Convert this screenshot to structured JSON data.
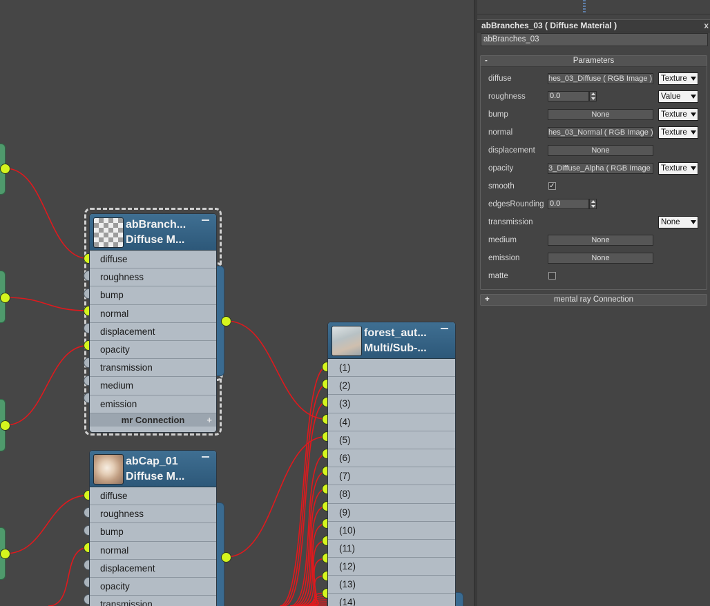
{
  "node_editor": {
    "nodes": [
      {
        "title_line1": "abBranch...",
        "title_line2": "Diffuse M...",
        "slots": [
          {
            "label": "diffuse",
            "connected": true
          },
          {
            "label": "roughness",
            "connected": false
          },
          {
            "label": "bump",
            "connected": false
          },
          {
            "label": "normal",
            "connected": true
          },
          {
            "label": "displacement",
            "connected": false
          },
          {
            "label": "opacity",
            "connected": true
          },
          {
            "label": "transmission",
            "connected": false
          },
          {
            "label": "medium",
            "connected": false
          },
          {
            "label": "emission",
            "connected": false
          }
        ],
        "mr_connection_label": "mr Connection",
        "mr_connection_plus": "+"
      },
      {
        "title_line1": "abCap_01",
        "title_line2": "Diffuse M...",
        "slots": [
          {
            "label": "diffuse",
            "connected": true
          },
          {
            "label": "roughness",
            "connected": false
          },
          {
            "label": "bump",
            "connected": false
          },
          {
            "label": "normal",
            "connected": true
          },
          {
            "label": "displacement",
            "connected": false
          },
          {
            "label": "opacity",
            "connected": false
          },
          {
            "label": "transmission",
            "connected": false
          }
        ]
      },
      {
        "title_line1": "forest_aut...",
        "title_line2": "Multi/Sub-...",
        "slots": [
          "(1)",
          "(2)",
          "(3)",
          "(4)",
          "(5)",
          "(6)",
          "(7)",
          "(8)",
          "(9)",
          "(10)",
          "(11)",
          "(12)",
          "(13)",
          "(14)"
        ]
      }
    ],
    "wire_color": "#e0191d",
    "port_on_color": "#d5f51e"
  },
  "parameter_panel": {
    "title": "abBranches_03  ( Diffuse Material )",
    "close_glyph": "x",
    "name_value": "abBranches_03",
    "rollout_title": "Parameters",
    "rollout_sign": "-",
    "params": [
      {
        "label": "diffuse",
        "button": "hes_03_Diffuse  ( RGB Image )",
        "dropdown": "Texture"
      },
      {
        "label": "roughness",
        "spinner": "0.0",
        "dropdown": "Value"
      },
      {
        "label": "bump",
        "button": "None",
        "dropdown": "Texture"
      },
      {
        "label": "normal",
        "button": "hes_03_Normal  ( RGB Image )",
        "dropdown": "Texture"
      },
      {
        "label": "displacement",
        "button": "None"
      },
      {
        "label": "opacity",
        "button": "3_Diffuse_Alpha  ( RGB Image )",
        "dropdown": "Texture"
      },
      {
        "label": "smooth",
        "checked": true
      },
      {
        "label": "edgesRounding",
        "spinner": "0.0"
      },
      {
        "label": "transmission",
        "dropdown": "None"
      },
      {
        "label": "medium",
        "button": "None"
      },
      {
        "label": "emission",
        "button": "None"
      },
      {
        "label": "matte",
        "checked": false
      }
    ],
    "mr_rollout_title": "mental ray Connection",
    "mr_rollout_sign": "+"
  }
}
